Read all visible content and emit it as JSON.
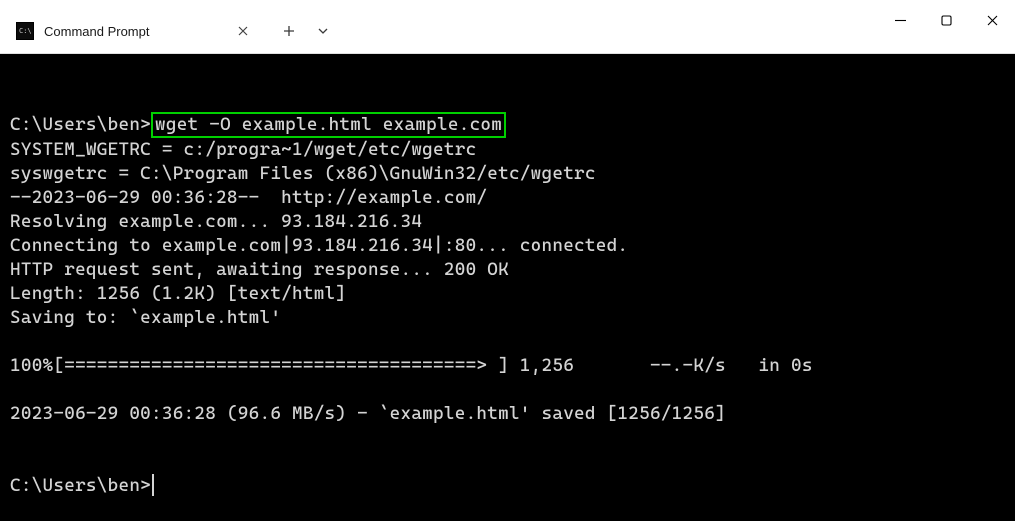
{
  "titlebar": {
    "tab": {
      "title": "Command Prompt"
    }
  },
  "terminal": {
    "prompt1_path": "C:\\Users\\ben>",
    "command": "wget -O example.html example.com",
    "output": {
      "l0": "",
      "l1": "SYSTEM_WGETRC = c:/progra~1/wget/etc/wgetrc",
      "l2": "syswgetrc = C:\\Program Files (x86)\\GnuWin32/etc/wgetrc",
      "l3": "--2023-06-29 00:36:28--  http://example.com/",
      "l4": "Resolving example.com... 93.184.216.34",
      "l5": "Connecting to example.com|93.184.216.34|:80... connected.",
      "l6": "HTTP request sent, awaiting response... 200 OK",
      "l7": "Length: 1256 (1.2K) [text/html]",
      "l8": "Saving to: `example.html'",
      "l9": "",
      "l10": "100%[======================================> ] 1,256       --.-K/s   in 0s",
      "l11": "",
      "l12": "2023-06-29 00:36:28 (96.6 MB/s) - `example.html' saved [1256/1256]",
      "l13": ""
    },
    "prompt2_path": "C:\\Users\\ben>"
  }
}
